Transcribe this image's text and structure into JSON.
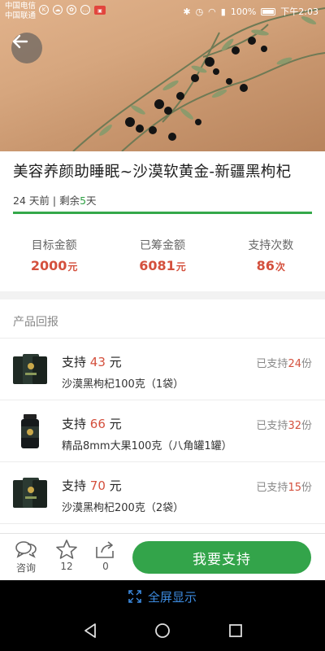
{
  "status_bar": {
    "carrier1": "中国电信",
    "carrier2": "中国联通",
    "battery": "100%",
    "time": "下午2:03"
  },
  "project": {
    "title": "美容养颜助睡眠~沙漠软黄金-新疆黑枸杞",
    "days_ago": "24 天前",
    "separator": " | ",
    "remaining_prefix": "剩余",
    "remaining_days": "5",
    "remaining_suffix": "天",
    "progress": 1.0
  },
  "stats": [
    {
      "label": "目标金额",
      "value": "2000",
      "unit": "元"
    },
    {
      "label": "已筹金额",
      "value": "6081",
      "unit": "元"
    },
    {
      "label": "支持次数",
      "value": "86",
      "unit": "次"
    }
  ],
  "rewards_section_title": "产品回报",
  "rewards": [
    {
      "support_prefix": "支持",
      "amount": "43",
      "unit": "元",
      "count_prefix": "已支持",
      "count": "24",
      "count_suffix": "份",
      "desc": "沙漠黑枸杞100克（1袋）"
    },
    {
      "support_prefix": "支持",
      "amount": "66",
      "unit": "元",
      "count_prefix": "已支持",
      "count": "32",
      "count_suffix": "份",
      "desc": "精品8mm大果100克（八角罐1罐）"
    },
    {
      "support_prefix": "支持",
      "amount": "70",
      "unit": "元",
      "count_prefix": "已支持",
      "count": "15",
      "count_suffix": "份",
      "desc": "沙漠黑枸杞200克（2袋）"
    }
  ],
  "bottom_bar": {
    "consult_label": "咨询",
    "favorite_count": "12",
    "share_count": "0",
    "support_button": "我要支持"
  },
  "fullscreen_label": "全屏显示",
  "colors": {
    "accent_green": "#33a44a",
    "accent_red": "#d4503d",
    "link_blue": "#3d8be0"
  }
}
